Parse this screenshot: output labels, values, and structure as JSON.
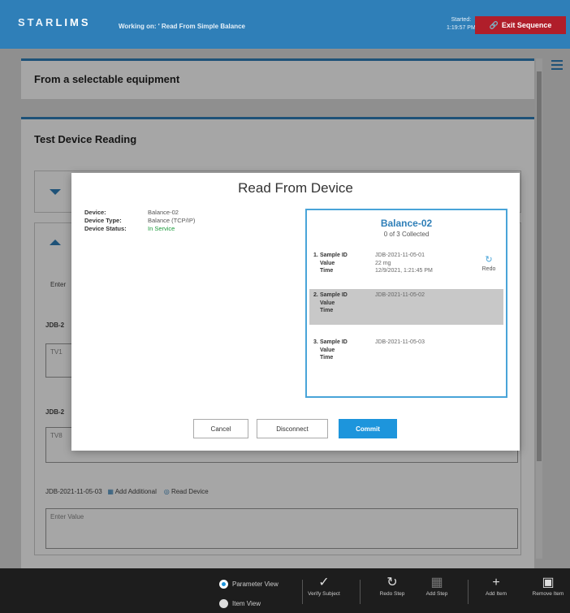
{
  "header": {
    "logo_star": "STAR",
    "logo_lims": "LIMS",
    "working_on": "Working on: ' Read From Simple Balance",
    "started_label": "Started:",
    "started_time": "1:19:57 PM",
    "exit_label": "Exit Sequence"
  },
  "background": {
    "panel1_title": "From a selectable equipment",
    "panel2_title": "Test Device Reading",
    "enter_hint": "Enter",
    "row1_label": "JDB-2",
    "row1_value": "TV1",
    "row2_label": "JDB-2",
    "row2_value": "TV8",
    "row3_label": "JDB-2021-11-05-03",
    "add_additional": "Add Additional",
    "read_device": "Read Device",
    "row3_placeholder": "Enter Value"
  },
  "modal": {
    "title": "Read From Device",
    "device_key": "Device:",
    "device_val": "Balance-02",
    "type_key": "Device Type:",
    "type_val": "Balance (TCP/IP)",
    "status_key": "Device Status:",
    "status_val": "In Service",
    "collect_name": "Balance-02",
    "collect_count": "0 of 3 Collected",
    "samples": [
      {
        "num": "1.",
        "id_key": "Sample ID",
        "id_val": "JDB-2021-11-05-01",
        "value_key": "Value",
        "value_val": "22 mg",
        "time_key": "Time",
        "time_val": "12/9/2021, 1:21:45 PM"
      },
      {
        "num": "2.",
        "id_key": "Sample ID",
        "id_val": "JDB-2021-11-05-02",
        "value_key": "Value",
        "value_val": "",
        "time_key": "Time",
        "time_val": ""
      },
      {
        "num": "3.",
        "id_key": "Sample ID",
        "id_val": "JDB-2021-11-05-03",
        "value_key": "Value",
        "value_val": "",
        "time_key": "Time",
        "time_val": ""
      }
    ],
    "redo_label": "Redo",
    "cancel_label": "Cancel",
    "disconnect_label": "Disconnect",
    "commit_label": "Commit"
  },
  "toolbar": {
    "parameter_view": "Parameter View",
    "item_view": "Item View",
    "verify_subject": "Verify Subject",
    "redo_step": "Redo Step",
    "add_step": "Add Step",
    "add_item": "Add Item",
    "remove_item": "Remove Item"
  },
  "colors": {
    "brand_blue": "#2f7fb8",
    "exit_red": "#b01e2a",
    "commit_blue": "#1d95dc",
    "status_green": "#1a9a3a"
  }
}
